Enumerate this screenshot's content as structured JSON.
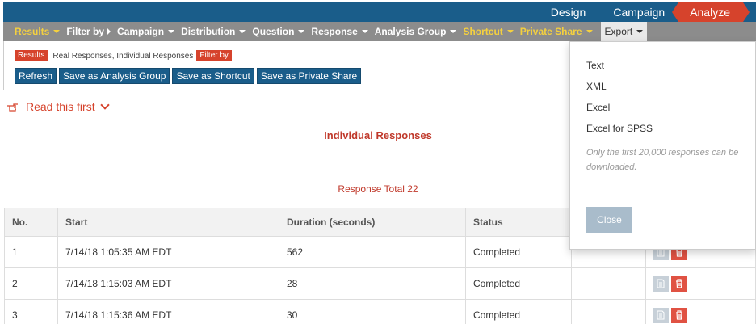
{
  "topnav": {
    "design": "Design",
    "campaign": "Campaign",
    "analyze": "Analyze"
  },
  "menubar": {
    "results": "Results",
    "filter_by": "Filter by",
    "campaign": "Campaign",
    "distribution": "Distribution",
    "question": "Question",
    "response": "Response",
    "analysis_group": "Analysis Group",
    "shortcut": "Shortcut",
    "private_share": "Private Share",
    "export": "Export"
  },
  "filter": {
    "results_tag": "Results",
    "description": "Real Responses, Individual Responses",
    "filter_tag": "Filter by",
    "buttons": {
      "refresh": "Refresh",
      "save_analysis_group": "Save as Analysis Group",
      "save_shortcut": "Save as Shortcut",
      "save_private_share": "Save as Private Share"
    }
  },
  "read_first": "Read this first",
  "page_title": "Individual Responses",
  "response_total": "Response Total 22",
  "table": {
    "headers": {
      "no": "No.",
      "start": "Start",
      "duration": "Duration (seconds)",
      "status": "Status"
    },
    "rows": [
      {
        "no": "1",
        "start": "7/14/18 1:05:35 AM EDT",
        "duration": "562",
        "status": "Completed"
      },
      {
        "no": "2",
        "start": "7/14/18 1:15:03 AM EDT",
        "duration": "28",
        "status": "Completed"
      },
      {
        "no": "3",
        "start": "7/14/18 1:15:36 AM EDT",
        "duration": "30",
        "status": "Completed"
      }
    ]
  },
  "export_menu": {
    "options": [
      "Text",
      "XML",
      "Excel",
      "Excel for SPSS"
    ],
    "note": "Only the first 20,000 responses can be downloaded.",
    "close": "Close"
  },
  "colors": {
    "nav_blue": "#1a5d8a",
    "accent_red": "#d6432c",
    "menu_gray": "#8c8c8c",
    "menu_yellow": "#f4d03f"
  }
}
